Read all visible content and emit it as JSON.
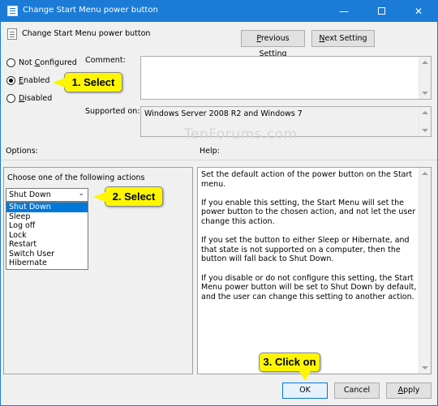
{
  "window": {
    "title": "Change Start Menu power button",
    "minimize_glyph": "—",
    "close_glyph": "✕"
  },
  "header": {
    "policy_title": "Change Start Menu power button",
    "prev_button": "Previous Setting",
    "next_button": "Next Setting"
  },
  "state": {
    "options": [
      {
        "label": "Not Configured",
        "selected": false
      },
      {
        "label": "Enabled",
        "selected": true
      },
      {
        "label": "Disabled",
        "selected": false
      }
    ]
  },
  "comment": {
    "label": "Comment:",
    "value": ""
  },
  "supported": {
    "label": "Supported on:",
    "value": "Windows Server 2008 R2 and Windows 7"
  },
  "watermark": "TenForums.com",
  "sections": {
    "options_label": "Options:",
    "help_label": "Help:"
  },
  "options_panel": {
    "instruction": "Choose one of the following actions",
    "selected_value": "Shut Down",
    "dropdown_items": [
      "Shut Down",
      "Sleep",
      "Log off",
      "Lock",
      "Restart",
      "Switch User",
      "Hibernate"
    ],
    "highlighted_index": 0
  },
  "help_panel": {
    "paragraphs": [
      "Set the default action of the power button on the Start menu.",
      "If you enable this setting, the Start Menu will set the power button to the chosen action, and not let the user change this action.",
      "If you set the button to either Sleep or Hibernate, and that state is not supported on a computer, then the button will fall back to Shut Down.",
      "If you disable or do not configure this setting, the Start Menu power button will be set to Shut Down by default, and the user can change this setting to another action."
    ]
  },
  "footer": {
    "ok": "OK",
    "cancel": "Cancel",
    "apply": "Apply"
  },
  "callouts": {
    "step1": "1. Select",
    "step2": "2. Select",
    "step3": "3. Click on",
    "color": "#fdf600"
  },
  "colors": {
    "titlebar": "#1a7cd6",
    "selection": "#0078d7",
    "dialog_bg": "#f0f0f0"
  }
}
